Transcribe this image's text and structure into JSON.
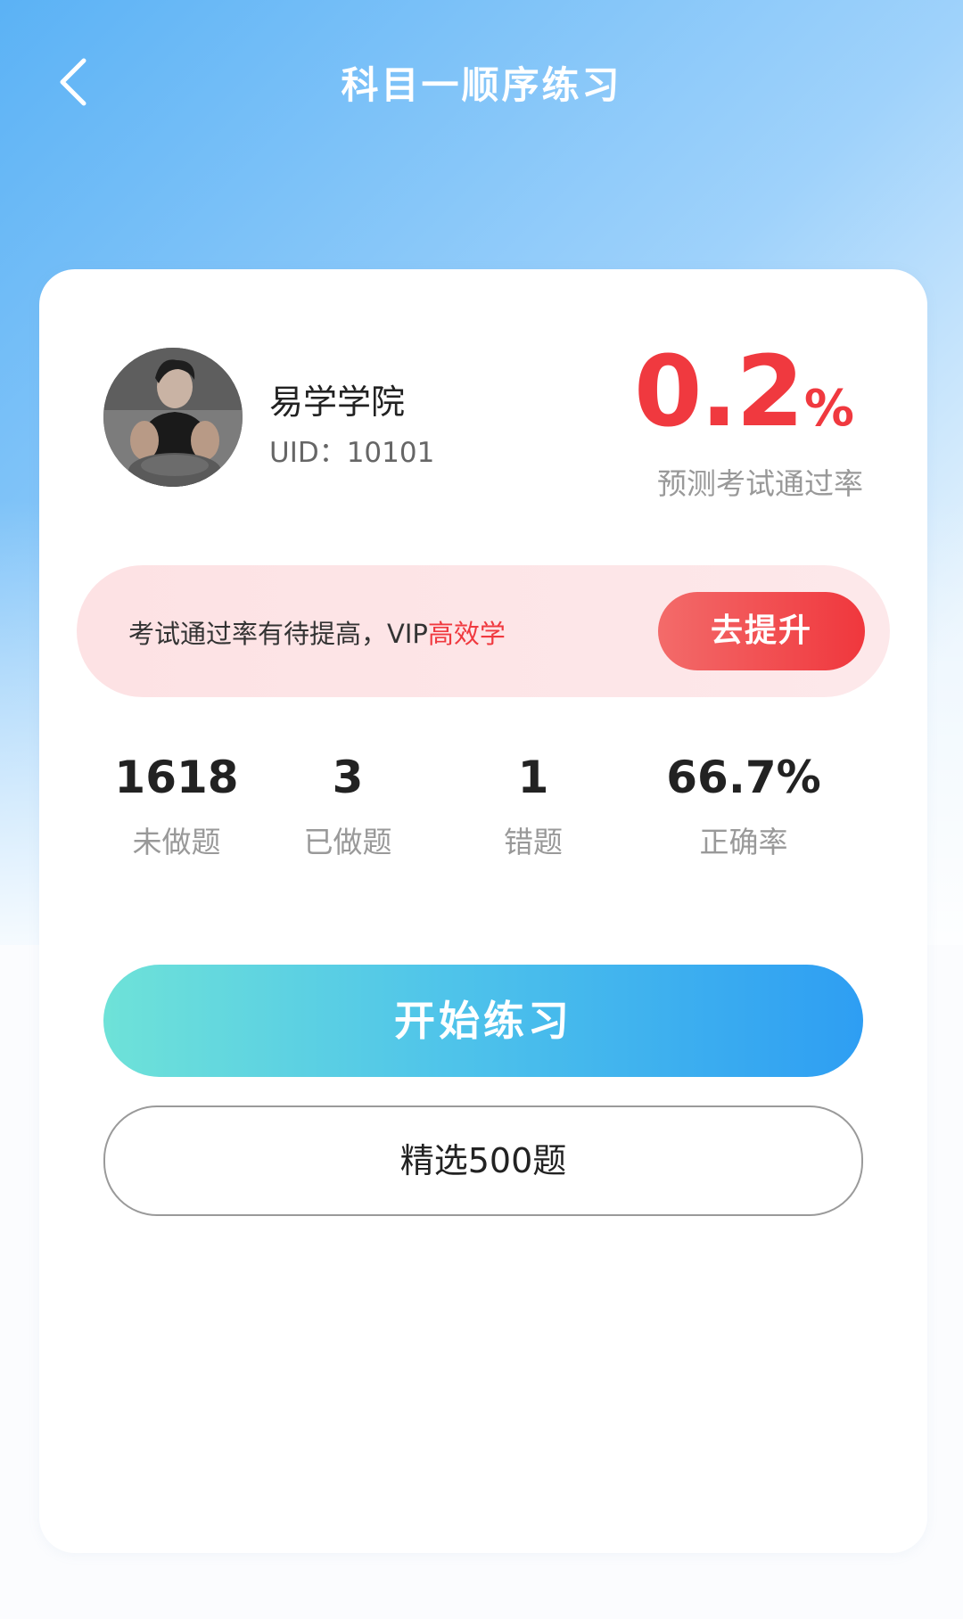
{
  "header": {
    "title": "科目一顺序练习"
  },
  "user": {
    "name": "易学学院",
    "uid": "UID：10101"
  },
  "pass_rate": {
    "value": "0.2",
    "unit": "%",
    "label": "预测考试通过率"
  },
  "promo": {
    "text": "考试通过率有待提高，VIP",
    "highlight": "高效学",
    "button_label": "去提升"
  },
  "stats": [
    {
      "value": "1618",
      "label": "未做题"
    },
    {
      "value": "3",
      "label": "已做题"
    },
    {
      "value": "1",
      "label": "错题"
    },
    {
      "value": "66.7%",
      "label": "正确率"
    }
  ],
  "actions": {
    "start_label": "开始练习",
    "select_label": "精选500题"
  },
  "colors": {
    "accent_red": "#f0393f",
    "accent_blue": "#2e9ef3",
    "accent_teal": "#6ee2d8"
  }
}
